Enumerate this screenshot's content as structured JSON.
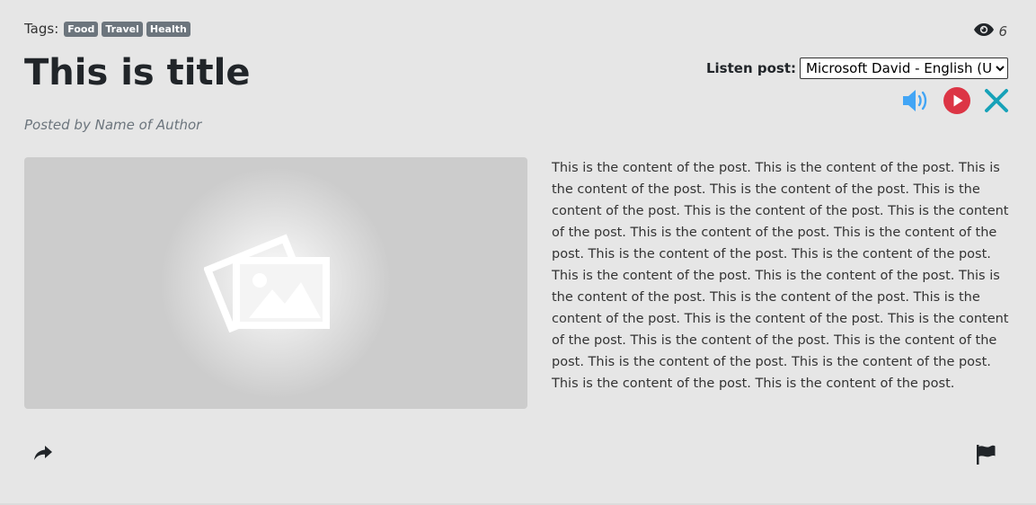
{
  "tags": {
    "label": "Tags:",
    "items": [
      "Food",
      "Travel",
      "Health"
    ]
  },
  "views": {
    "icon": "eye-icon",
    "count": "6"
  },
  "post": {
    "title": "This is title",
    "author": "Posted by Name of Author",
    "content": "This is the content of the post. This is the content of the post. This is the content of the post. This is the content of the post. This is the content of the post. This is the content of the post. This is the content of the post. This is the content of the post. This is the content of the post. This is the content of the post. This is the content of the post. This is the content of the post. This is the content of the post. This is the content of the post. This is the content of the post. This is the content of the post. This is the content of the post. This is the content of the post. This is the content of the post. This is the content of the post. This is the content of the post. This is the content of the post. This is the content of the post. This is the content of the post."
  },
  "listen": {
    "label": "Listen post:",
    "voice_selected": "Microsoft David - English (United States)"
  },
  "player": {
    "icons": [
      "volume-icon",
      "play-icon",
      "close-icon"
    ]
  },
  "actions": {
    "icons": [
      "share-icon",
      "flag-icon"
    ]
  },
  "colors": {
    "tag_bg": "#6c757d",
    "play_red": "#dc3545",
    "close_cyan": "#17a2b8",
    "volume_blue": "#42a5f5"
  }
}
